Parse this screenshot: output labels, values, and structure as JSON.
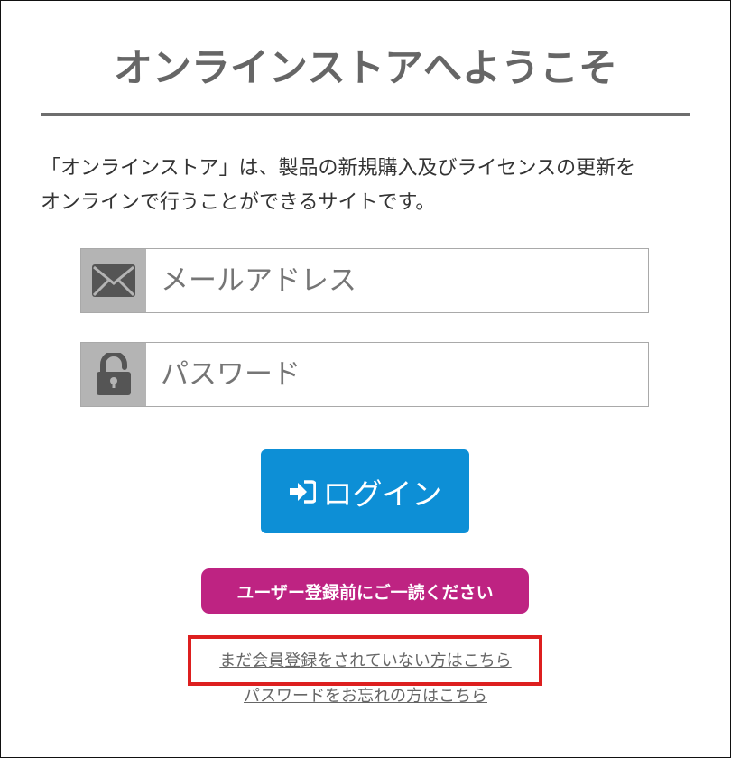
{
  "header": {
    "title": "オンラインストアへようこそ"
  },
  "intro": {
    "line1": "「オンラインストア」は、製品の新規購入及びライセンスの更新を",
    "line2": "オンラインで行うことができるサイトです。"
  },
  "login_form": {
    "email": {
      "icon": "envelope-icon",
      "placeholder": "メールアドレス",
      "value": ""
    },
    "password": {
      "icon": "unlocked-padlock-icon",
      "placeholder": "パスワード",
      "value": ""
    },
    "submit": {
      "icon": "sign-in-icon",
      "label": "ログイン"
    }
  },
  "notice_button": {
    "label": "ユーザー登録前にご一読ください"
  },
  "links": {
    "register": "まだ会員登録をされていない方はこちら",
    "forgot_password": "パスワードをお忘れの方はこちら"
  },
  "colors": {
    "title": "#666666",
    "icon_box": "#b4b4b4",
    "login_button": "#0d8fd6",
    "notice_button": "#be2382",
    "highlight_border": "#dd1f1f"
  }
}
